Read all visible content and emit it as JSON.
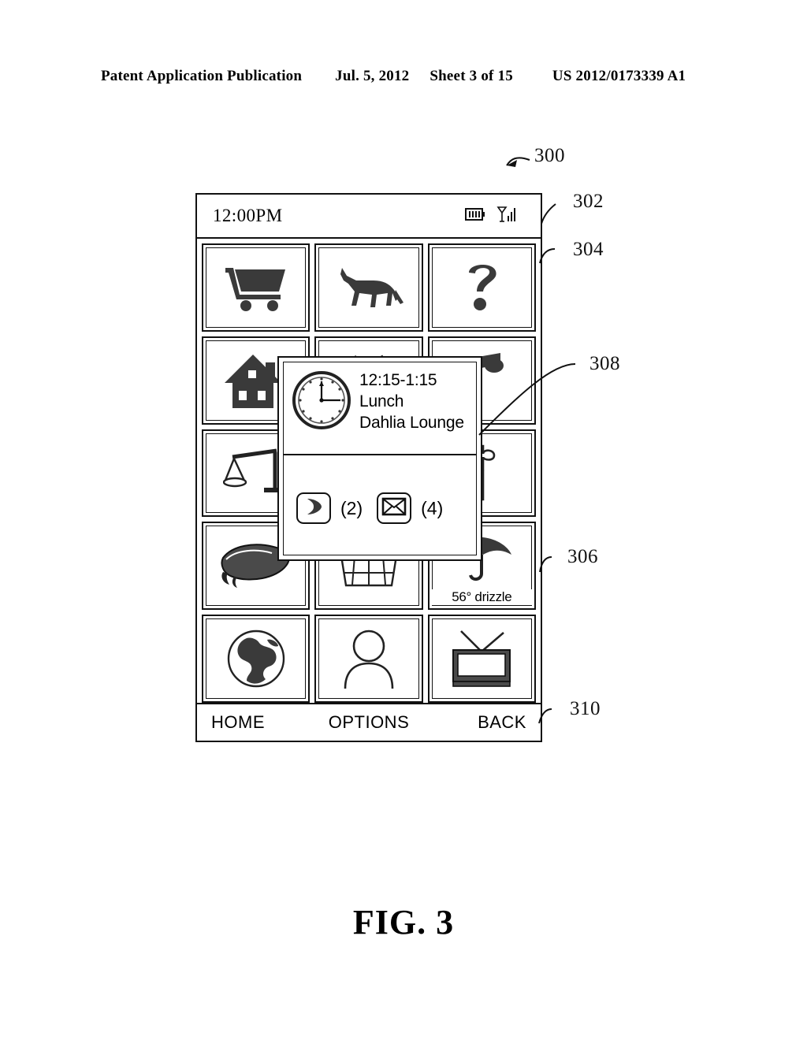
{
  "page": {
    "header": {
      "publication": "Patent Application Publication",
      "date": "Jul. 5, 2012",
      "sheet": "Sheet 3 of 15",
      "doc_number": "US 2012/0173339 A1"
    },
    "figure_caption": "FIG. 3"
  },
  "device": {
    "status_bar": {
      "time": "12:00PM",
      "icons": [
        "battery-icon",
        "signal-bars-icon"
      ]
    },
    "grid": {
      "tiles": [
        {
          "name": "shopping-cart",
          "icon": "shopping-cart-icon",
          "label": ""
        },
        {
          "name": "animal",
          "icon": "horse-icon",
          "label": ""
        },
        {
          "name": "help",
          "icon": "question-mark-icon",
          "label": ""
        },
        {
          "name": "home",
          "icon": "house-icon",
          "label": ""
        },
        {
          "name": "garden",
          "icon": "potted-plant-icon",
          "label": ""
        },
        {
          "name": "music",
          "icon": "music-note-icon",
          "label": ""
        },
        {
          "name": "legal",
          "icon": "scales-of-justice-icon",
          "label": ""
        },
        {
          "name": "calendar-event",
          "icon": "blank-icon",
          "label": ""
        },
        {
          "name": "puzzle",
          "icon": "puzzle-piece-icon",
          "label": ""
        },
        {
          "name": "education",
          "icon": "graduation-cap-icon",
          "label": ""
        },
        {
          "name": "basket",
          "icon": "basket-icon",
          "label": ""
        },
        {
          "name": "weather",
          "icon": "umbrella-icon",
          "label": "56° drizzle"
        },
        {
          "name": "world",
          "icon": "globe-icon",
          "label": ""
        },
        {
          "name": "contacts",
          "icon": "person-icon",
          "label": ""
        },
        {
          "name": "television",
          "icon": "tv-icon",
          "label": ""
        }
      ]
    },
    "soft_keys": {
      "left": "HOME",
      "center": "OPTIONS",
      "right": "BACK"
    }
  },
  "popup": {
    "icon": "analog-clock-icon",
    "time_range": "12:15-1:15",
    "title": "Lunch",
    "location": "Dahlia Lounge",
    "items": [
      {
        "icon": "phone-handset-icon",
        "count": "(2)"
      },
      {
        "icon": "envelope-icon",
        "count": "(4)"
      }
    ]
  },
  "reference_numerals": {
    "device": "300",
    "status_bar": "302",
    "grid": "304",
    "tile": "306",
    "popup": "308",
    "soft_keys": "310"
  }
}
